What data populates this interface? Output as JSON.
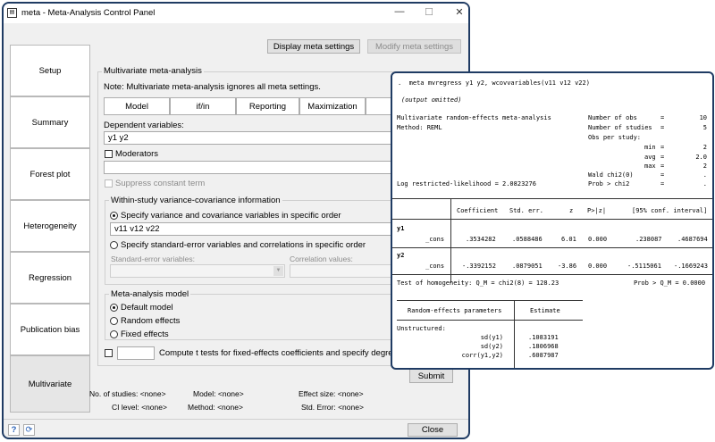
{
  "window": {
    "title": "meta - Meta-Analysis Control Panel",
    "minimize": "—",
    "maximize": "☐",
    "close": "✕"
  },
  "toolbar": {
    "display_settings": "Display meta settings",
    "modify_settings": "Modify meta settings"
  },
  "sidebar": {
    "items": [
      {
        "label": "Setup"
      },
      {
        "label": "Summary"
      },
      {
        "label": "Forest plot"
      },
      {
        "label": "Heterogeneity"
      },
      {
        "label": "Regression"
      },
      {
        "label": "Publication bias"
      },
      {
        "label": "Multivariate"
      }
    ]
  },
  "panel": {
    "group_title": "Multivariate meta-analysis",
    "note": "Note: Multivariate meta-analysis ignores all meta settings.",
    "tabs": [
      {
        "label": "Model"
      },
      {
        "label": "if/in"
      },
      {
        "label": "Reporting"
      },
      {
        "label": "Maximization"
      }
    ],
    "dep_label": "Dependent variables:",
    "dep_value": "y1 y2",
    "moderators_label": "Moderators",
    "suppress_label": "Suppress constant term",
    "within_title": "Within-study variance-covariance information",
    "opt_specify_var": "Specify variance and covariance variables in specific order",
    "var_value": "v11 v12 v22",
    "opt_specify_se": "Specify standard-error variables and correlations in specific order",
    "se_label": "Standard-error variables:",
    "corr_label": "Correlation values:",
    "model_title": "Meta-analysis model",
    "model_default": "Default model",
    "model_random": "Random effects",
    "model_fixed": "Fixed effects",
    "compute_label": "Compute t tests for fixed-effects coefficients and specify degrees of"
  },
  "submit": "Submit",
  "close": "Close",
  "status": {
    "studies": "No. of studies: <none>",
    "model": "Model: <none>",
    "effect_size": "Effect size: <none>",
    "ci_level": "CI level: <none>",
    "method": "Method: <none>",
    "std_error": "Std. Error: <none>"
  },
  "output": {
    "command": ".  meta mvregress y1 y2, wcovvariables(v11 v12 v22)",
    "omitted": "(output omitted)",
    "header_left1": "Multivariate random-effects meta-analysis",
    "header_left2": "Method: REML",
    "n_obs_label": "Number of obs",
    "n_obs": "10",
    "n_studies_label": "Number of studies",
    "n_studies": "5",
    "obs_per_study": "Obs per study:",
    "min_label": "min",
    "min": "2",
    "avg_label": "avg",
    "avg": "2.0",
    "max_label": "max",
    "max": "2",
    "loglik": "Log restricted-likelihood = 2.0823276",
    "wald_label": "Wald chi2(0)",
    "wald": ".",
    "prob_label": "Prob > chi2",
    "prob": ".",
    "col_coef": "Coefficient",
    "col_se": "Std. err.",
    "col_z": "z",
    "col_p": "P>|z|",
    "col_ci": "[95% conf. interval]",
    "rows": [
      {
        "eq": "y1",
        "var": "_cons",
        "coef": ".3534282",
        "se": ".0588486",
        "z": "6.01",
        "p": "0.000",
        "lo": ".238087",
        "hi": ".4687694"
      },
      {
        "eq": "y2",
        "var": "_cons",
        "coef": "-.3392152",
        "se": ".0879051",
        "z": "-3.86",
        "p": "0.000",
        "lo": "-.5115061",
        "hi": "-.1669243"
      }
    ],
    "homog_left": "Test of homogeneity: Q_M = chi2(8) = 128.23",
    "homog_right": "Prob > Q_M = 0.0000",
    "re_title": "Random-effects parameters",
    "re_est": "Estimate",
    "re_struct": "Unstructured:",
    "re_rows": [
      {
        "name": "sd(y1)",
        "val": ".1083191"
      },
      {
        "name": "sd(y2)",
        "val": ".1806968"
      },
      {
        "name": "corr(y1,y2)",
        "val": ".6087987"
      }
    ]
  }
}
